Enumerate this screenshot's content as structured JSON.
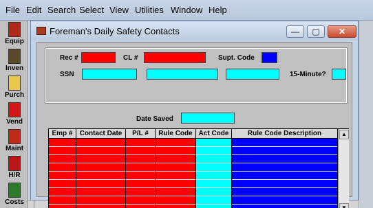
{
  "menu": [
    "File",
    "Edit",
    "Search",
    "Select",
    "View",
    "Utilities",
    "Window",
    "Help"
  ],
  "toolbar": [
    "Equip",
    "Inven",
    "Purch",
    "Vend",
    "Maint",
    "H/R",
    "Costs"
  ],
  "window": {
    "title": "Foreman's Daily Safety Contacts",
    "minimize": "—",
    "maximize": "▢",
    "close": "✕"
  },
  "form": {
    "rec_label": "Rec #",
    "cl_label": "CL #",
    "supt_label": "Supt. Code",
    "ssn_label": "SSN",
    "fifteen_label": "15-Minute?",
    "date_saved_label": "Date Saved"
  },
  "grid": {
    "columns": [
      "Emp #",
      "Contact Date",
      "P/L #",
      "Rule Code",
      "Act Code",
      "Rule Code Description"
    ],
    "scroll_up": "▲",
    "scroll_down": "▼"
  },
  "colors": {
    "field_red": "#ff0000",
    "field_cyan": "#00ffff",
    "field_blue": "#0000ff"
  }
}
